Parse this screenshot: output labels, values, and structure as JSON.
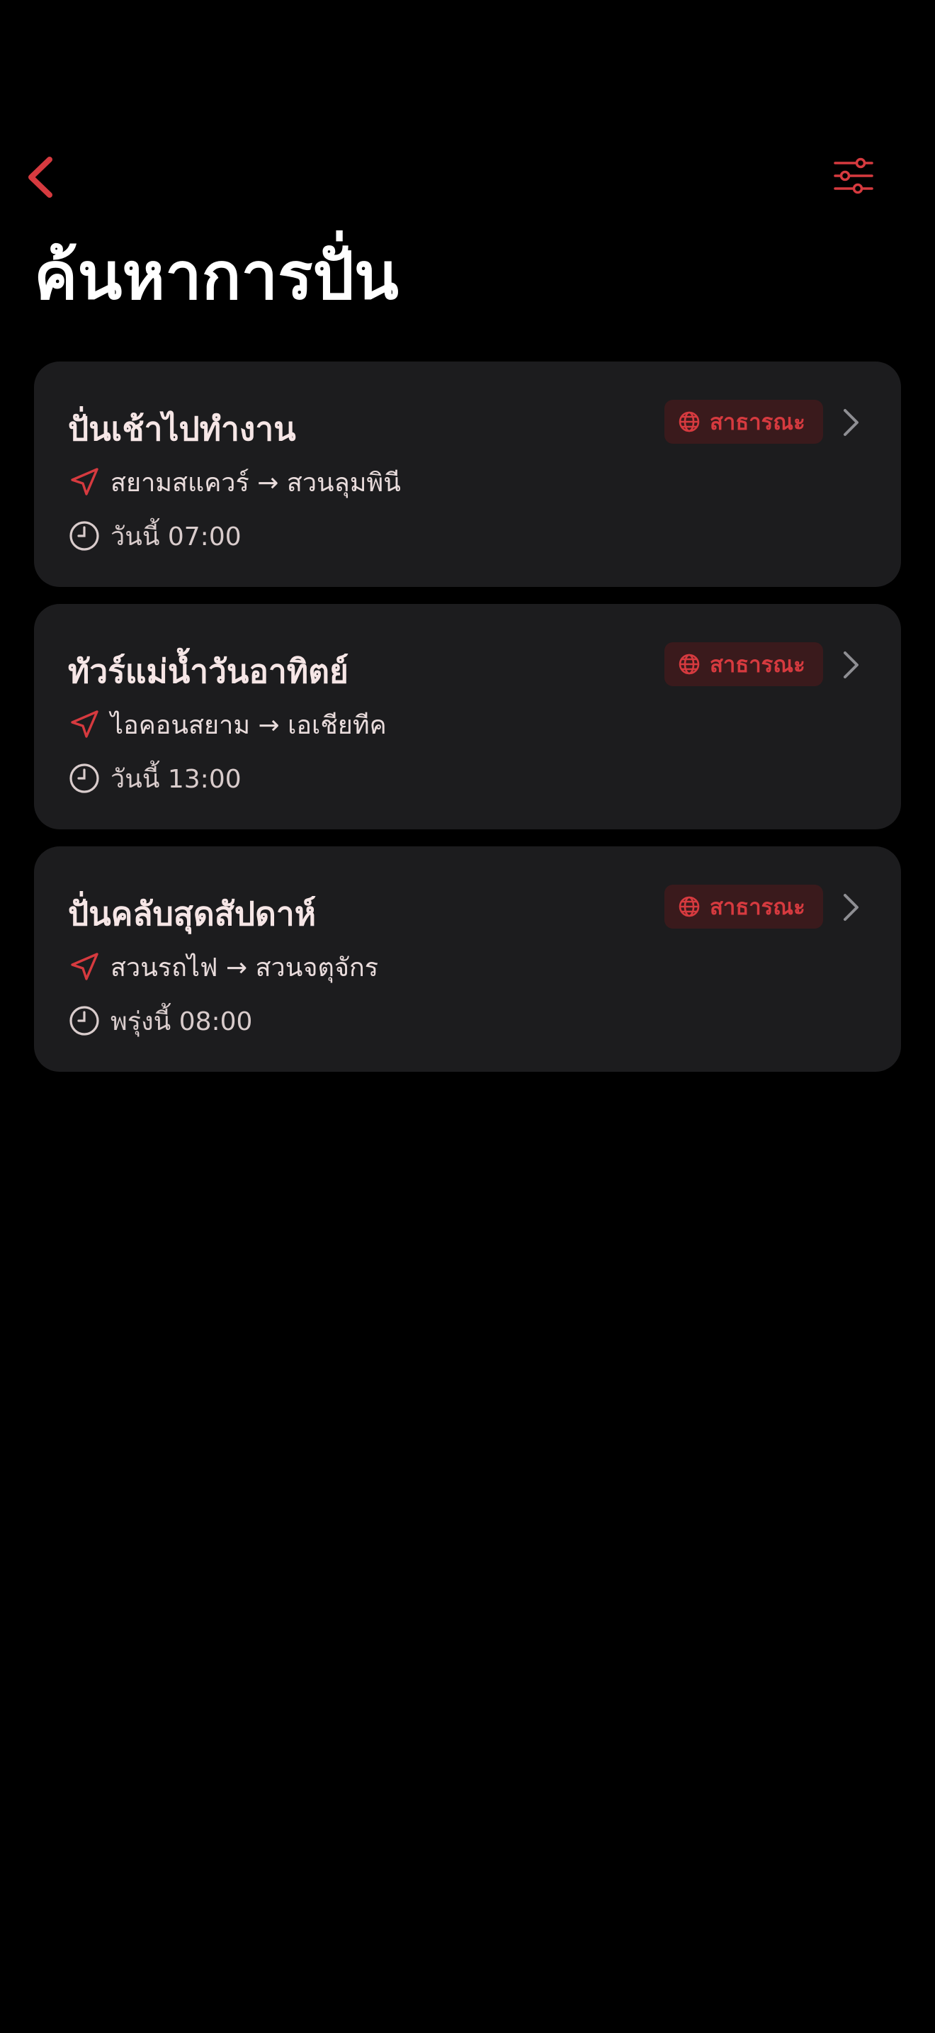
{
  "page": {
    "title": "ค้นหาการปั่น"
  },
  "colors": {
    "accent": "#d63a3f",
    "background": "#000000",
    "card": "#1c1c1e",
    "badge_bg": "#3a1a1c",
    "chevron": "#8e8e93"
  },
  "nav": {
    "back_icon": "chevron-left-icon",
    "filter_icon": "sliders-icon"
  },
  "rides": [
    {
      "title": "ปั่นเช้าไปทำงาน",
      "badge": "สาธารณะ",
      "route": "สยามสแควร์ → สวนลุมพินี",
      "time": "วันนี้ 07:00"
    },
    {
      "title": "ทัวร์แม่น้ำวันอาทิตย์",
      "badge": "สาธารณะ",
      "route": "ไอคอนสยาม → เอเชียทีค",
      "time": "วันนี้ 13:00"
    },
    {
      "title": "ปั่นคลับสุดสัปดาห์",
      "badge": "สาธารณะ",
      "route": "สวนรถไฟ → สวนจตุจักร",
      "time": "พรุ่งนี้ 08:00"
    }
  ],
  "icons": {
    "badge": "globe-icon",
    "route": "navigation-arrow-icon",
    "time": "clock-icon",
    "row_action": "chevron-right-icon"
  }
}
